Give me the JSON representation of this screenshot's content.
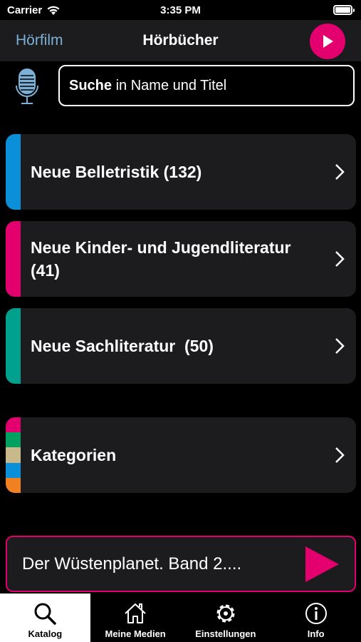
{
  "status_bar": {
    "carrier": "Carrier",
    "time": "3:35 PM"
  },
  "nav": {
    "left_label": "Hörfilm",
    "title": "Hörbücher",
    "play_icon": "play-icon"
  },
  "search": {
    "bold": "Suche",
    "rest": " in Name und Titel",
    "mic_icon": "microphone-icon"
  },
  "rows": [
    {
      "label": "Neue Belletristik (132)",
      "color": "#0a8fd8"
    },
    {
      "label": "Neue Kinder- und Jugendliteratur (41)",
      "color": "#e3006e"
    },
    {
      "label": "Neue Sachliteratur  (50)",
      "color": "#00a08e"
    },
    {
      "label": "Kategorien",
      "colors": [
        "#e3006e",
        "#00a060",
        "#c8b88a",
        "#0a8fd8",
        "#f08020"
      ]
    }
  ],
  "now_playing": {
    "title": "Der Wüstenplanet. Band 2....",
    "accent": "#e3006e"
  },
  "tabs": [
    {
      "label": "Katalog",
      "icon": "search-icon",
      "active": true
    },
    {
      "label": "Meine Medien",
      "icon": "home-icon",
      "active": false
    },
    {
      "label": "Einstellungen",
      "icon": "gear-icon",
      "active": false
    },
    {
      "label": "Info",
      "icon": "info-icon",
      "active": false
    }
  ]
}
